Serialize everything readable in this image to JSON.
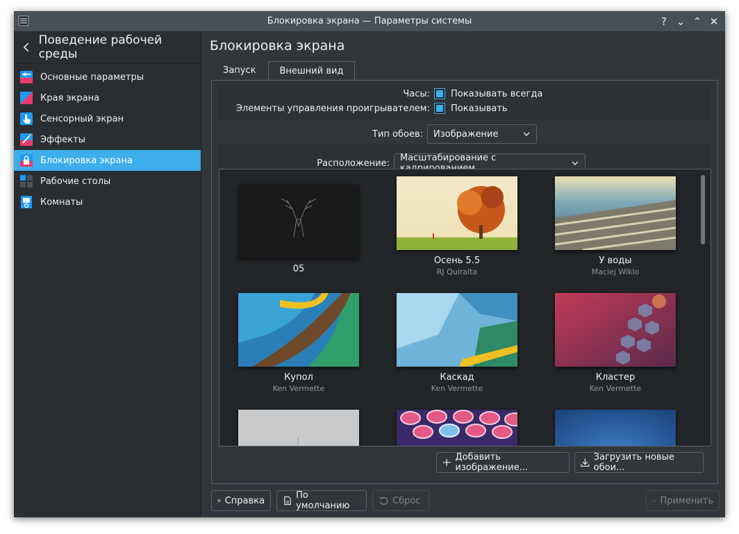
{
  "window": {
    "title": "Блокировка экрана — Параметры системы",
    "controls": [
      "?",
      "⌄",
      "⌃",
      "✕"
    ]
  },
  "sidebar": {
    "header": "Поведение рабочей среды",
    "items": [
      {
        "label": "Основные параметры",
        "icon": "general-settings-icon"
      },
      {
        "label": "Края экрана",
        "icon": "screen-edges-icon"
      },
      {
        "label": "Сенсорный экран",
        "icon": "touchscreen-icon"
      },
      {
        "label": "Эффекты",
        "icon": "effects-icon"
      },
      {
        "label": "Блокировка экрана",
        "icon": "lock-screen-icon",
        "active": true
      },
      {
        "label": "Рабочие столы",
        "icon": "virtual-desktops-icon"
      },
      {
        "label": "Комнаты",
        "icon": "activities-icon"
      }
    ]
  },
  "main": {
    "title": "Блокировка экрана",
    "tabs": [
      {
        "label": "Запуск",
        "active": false
      },
      {
        "label": "Внешний вид",
        "active": true
      }
    ],
    "clock": {
      "label": "Часы:",
      "checkbox_label": "Показывать всегда",
      "checked": true
    },
    "media": {
      "label": "Элементы управления проигрывателем:",
      "checkbox_label": "Показывать",
      "checked": true
    },
    "wallpaper_type": {
      "label": "Тип обоев:",
      "value": "Изображение"
    },
    "positioning": {
      "label": "Расположение:",
      "value": "Масштабирование с кадрированием"
    },
    "wallpapers": [
      {
        "name": "05",
        "author": ""
      },
      {
        "name": "Осень 5.5",
        "author": "RJ Quiralta"
      },
      {
        "name": "У воды",
        "author": "Maciej Wiklo"
      },
      {
        "name": "Купол",
        "author": "Ken Vermette"
      },
      {
        "name": "Каскад",
        "author": "Ken Vermette"
      },
      {
        "name": "Кластер",
        "author": "Ken Vermette"
      }
    ],
    "add_image_button": "Добавить изображение...",
    "get_new_button": "Загрузить новые обои..."
  },
  "footer": {
    "help": "Справка",
    "defaults": "По умолчанию",
    "reset": "Сброс",
    "apply": "Применить"
  },
  "colors": {
    "accent": "#3daee9",
    "window_bg": "#31363b",
    "sidebar_bg": "#2a2e32",
    "titlebar_bg": "#475057"
  }
}
